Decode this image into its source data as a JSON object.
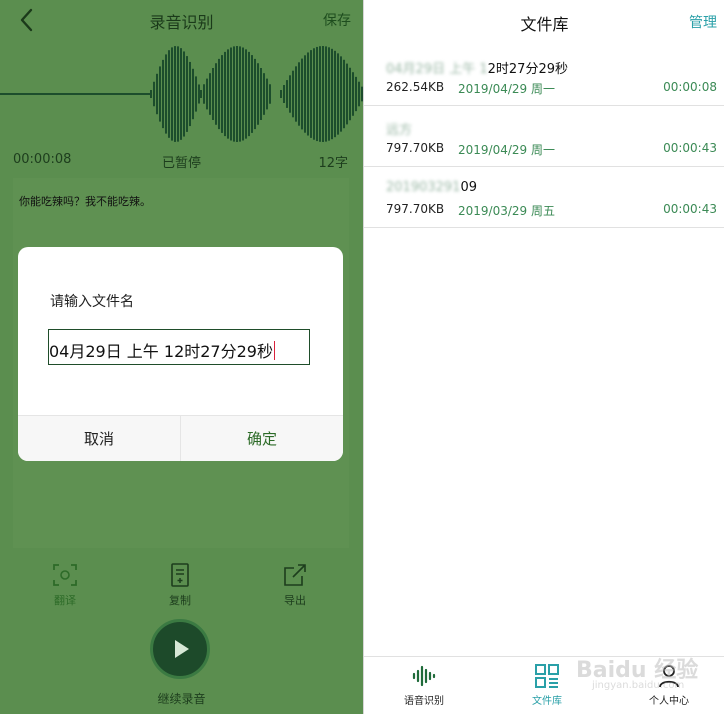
{
  "left": {
    "title": "录音识别",
    "save_label": "保存",
    "recording": {
      "time": "00:00:08",
      "status": "已暂停",
      "char_count": "12字"
    },
    "transcript": "你能吃辣吗？我不能吃辣。",
    "actions": {
      "translate": "翻译",
      "copy": "复制",
      "export": "导出"
    },
    "continue_label": "继续录音",
    "dialog": {
      "title": "请输入文件名",
      "input_value": "04月29日 上午 12时27分29秒",
      "cancel_label": "取消",
      "confirm_label": "确定"
    },
    "colors": {
      "overlay_green": "#5b8e4f",
      "accent_green": "#2d6b28",
      "caret_red": "#d9223c"
    }
  },
  "right": {
    "title": "文件库",
    "manage_label": "管理",
    "files": [
      {
        "name_blurred": "04月29日 上午 1",
        "name_visible": "2时27分29秒",
        "size": "262.54KB",
        "date": "2019/04/29 周一",
        "duration": "00:00:08"
      },
      {
        "name_blurred": "远方",
        "name_visible": "",
        "size": "797.70KB",
        "date": "2019/04/29 周一",
        "duration": "00:00:43"
      },
      {
        "name_blurred": "201903291",
        "name_visible": "09",
        "size": "797.70KB",
        "date": "2019/03/29 周五",
        "duration": "00:00:43"
      }
    ],
    "tabs": [
      {
        "label": "语音识别",
        "icon": "waveform-icon"
      },
      {
        "label": "文件库",
        "icon": "grid-icon"
      },
      {
        "label": "个人中心",
        "icon": "person-icon"
      }
    ],
    "colors": {
      "teal_accent": "#2aa0a8",
      "meta_green": "#3b8a55"
    }
  },
  "watermark": {
    "brand": "Baidu 经验",
    "sub": "jingyan.baidu.com"
  }
}
